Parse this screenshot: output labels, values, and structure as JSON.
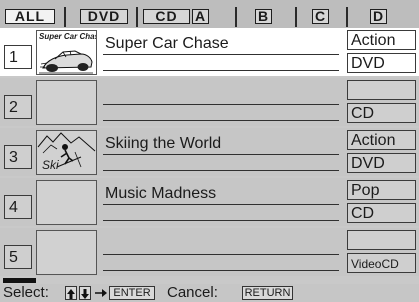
{
  "tabs": [
    {
      "label": "ALL",
      "active": true
    },
    {
      "label": "DVD",
      "active": false
    },
    {
      "label": "CD",
      "active": false
    },
    {
      "label": "A",
      "active": false
    },
    {
      "label": "B",
      "active": false
    },
    {
      "label": "C",
      "active": false
    },
    {
      "label": "D",
      "active": false
    }
  ],
  "rows": [
    {
      "number": "1",
      "title": "Super Car Chase",
      "thumb_caption": "Super Car Chase",
      "thumb_icon": "race-car-icon",
      "genre": "Action",
      "media": "DVD",
      "selected": true
    },
    {
      "number": "2",
      "title": "",
      "thumb_icon": "",
      "genre": "",
      "media": "CD",
      "selected": false
    },
    {
      "number": "3",
      "title": "Skiing the World",
      "thumb_caption": "Ski",
      "thumb_icon": "skier-icon",
      "genre": "Action",
      "media": "DVD",
      "selected": false
    },
    {
      "number": "4",
      "title": "Music Madness",
      "thumb_icon": "",
      "genre": "Pop",
      "media": "CD",
      "selected": false
    },
    {
      "number": "5",
      "title": "",
      "thumb_icon": "",
      "genre": "",
      "media": "VideoCD",
      "selected": false
    }
  ],
  "help": {
    "select_label": "Select:",
    "up_icon": "up-arrow-key-icon",
    "down_icon": "down-arrow-key-icon",
    "enter_arrow_icon": "right-arrow-icon",
    "enter_key": "ENTER",
    "cancel_label": "Cancel:",
    "return_key": "RETURN"
  },
  "colors": {
    "background": "#c9c9c9",
    "selected_row": "#ffffff",
    "border": "#1e1e1e"
  }
}
